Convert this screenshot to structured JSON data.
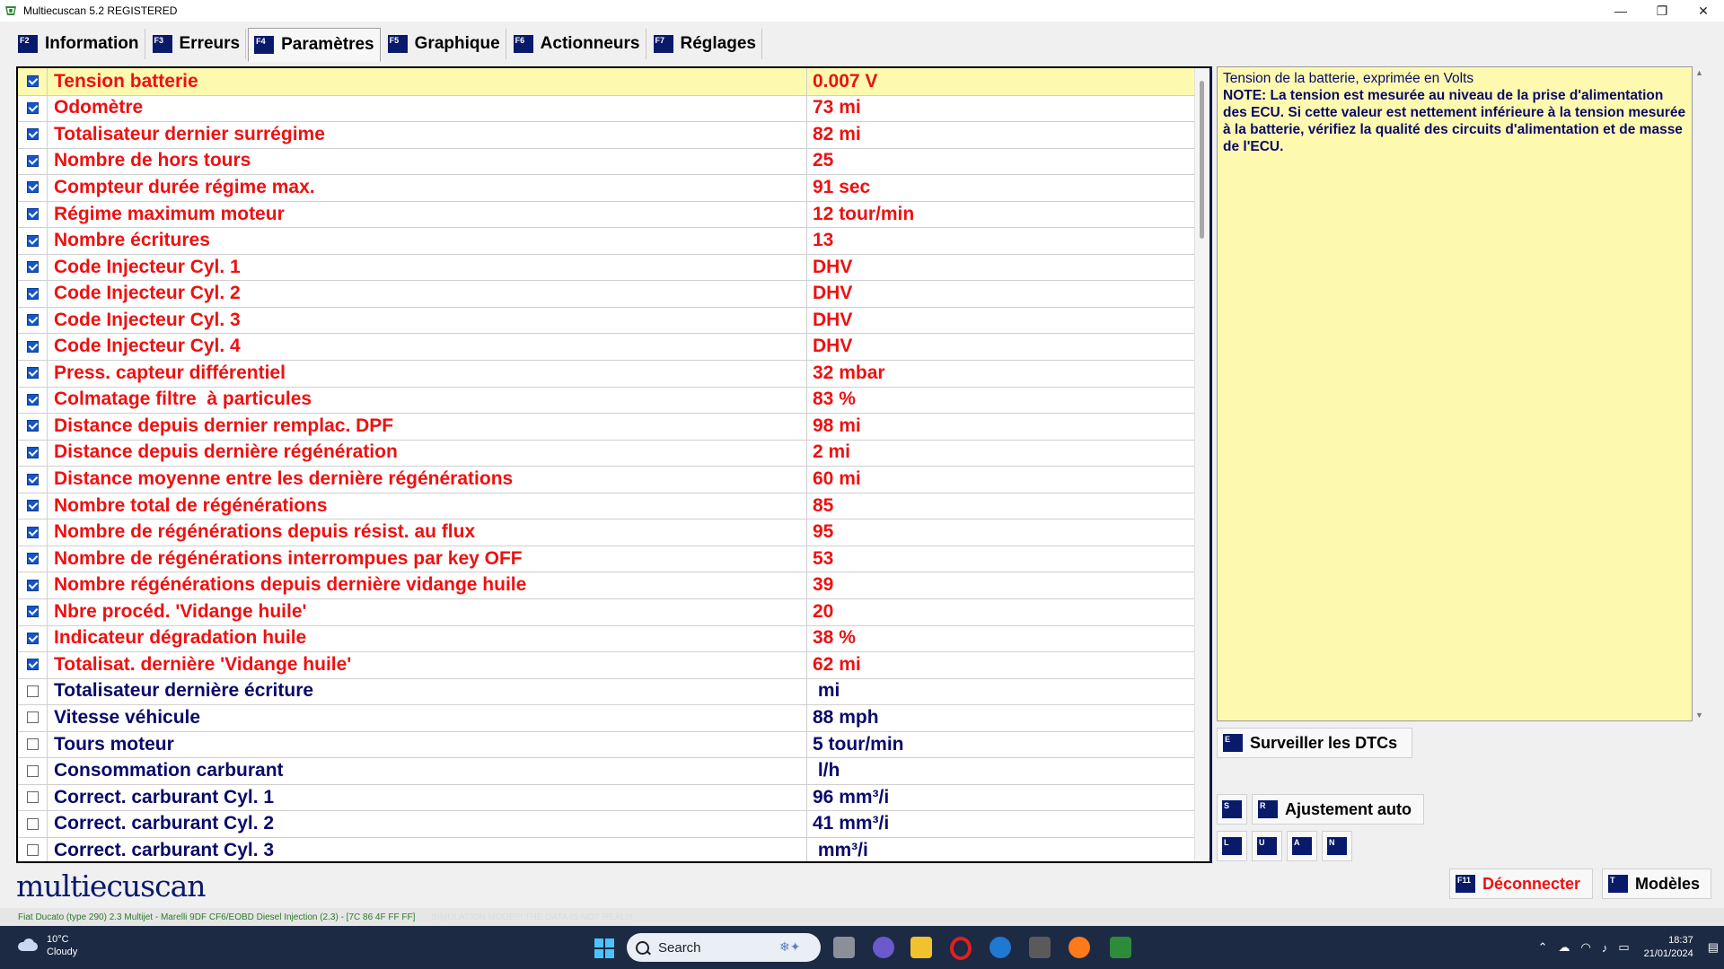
{
  "window": {
    "title": "Multiecuscan 5.2 REGISTERED",
    "controls": [
      "—",
      "❐",
      "✕"
    ]
  },
  "tabs": [
    {
      "key": "F2",
      "label": "Information"
    },
    {
      "key": "F3",
      "label": "Erreurs"
    },
    {
      "key": "F4",
      "label": "Paramètres"
    },
    {
      "key": "F5",
      "label": "Graphique"
    },
    {
      "key": "F6",
      "label": "Actionneurs"
    },
    {
      "key": "F7",
      "label": "Réglages"
    }
  ],
  "active_tab": "Paramètres",
  "parameters": [
    {
      "name": "Tension batterie",
      "value": "0.007 V",
      "checked": true
    },
    {
      "name": "Odomètre",
      "value": "73 mi",
      "checked": true
    },
    {
      "name": "Totalisateur dernier surrégime",
      "value": "82 mi",
      "checked": true
    },
    {
      "name": "Nombre de hors tours",
      "value": "25",
      "checked": true
    },
    {
      "name": "Compteur durée régime max.",
      "value": "91 sec",
      "checked": true
    },
    {
      "name": "Régime maximum moteur",
      "value": "12 tour/min",
      "checked": true
    },
    {
      "name": "Nombre écritures",
      "value": "13",
      "checked": true
    },
    {
      "name": "Code Injecteur Cyl. 1",
      "value": "DHV",
      "checked": true
    },
    {
      "name": "Code Injecteur Cyl. 2",
      "value": "DHV",
      "checked": true
    },
    {
      "name": "Code Injecteur Cyl. 3",
      "value": "DHV",
      "checked": true
    },
    {
      "name": "Code Injecteur Cyl. 4",
      "value": "DHV",
      "checked": true
    },
    {
      "name": "Press. capteur différentiel",
      "value": "32 mbar",
      "checked": true
    },
    {
      "name": "Colmatage filtre  à particules",
      "value": "83 %",
      "checked": true
    },
    {
      "name": "Distance depuis dernier remplac. DPF",
      "value": "98 mi",
      "checked": true
    },
    {
      "name": "Distance depuis dernière régénération",
      "value": "2 mi",
      "checked": true
    },
    {
      "name": "Distance moyenne entre les dernière régénérations",
      "value": "60 mi",
      "checked": true
    },
    {
      "name": "Nombre total de régénérations",
      "value": "85",
      "checked": true
    },
    {
      "name": "Nombre de régénérations depuis résist. au flux",
      "value": "95",
      "checked": true
    },
    {
      "name": "Nombre de régénérations interrompues par key OFF",
      "value": "53",
      "checked": true
    },
    {
      "name": "Nombre régénérations depuis dernière vidange huile",
      "value": "39",
      "checked": true
    },
    {
      "name": "Nbre procéd. 'Vidange huile'",
      "value": "20",
      "checked": true
    },
    {
      "name": "Indicateur dégradation huile",
      "value": "38 %",
      "checked": true
    },
    {
      "name": "Totalisat. dernière 'Vidange huile'",
      "value": "62 mi",
      "checked": true
    },
    {
      "name": "Totalisateur dernière écriture",
      "value": " mi",
      "checked": false
    },
    {
      "name": "Vitesse véhicule",
      "value": "88 mph",
      "checked": false
    },
    {
      "name": "Tours moteur",
      "value": "5 tour/min",
      "checked": false
    },
    {
      "name": "Consommation carburant",
      "value": " l/h",
      "checked": false
    },
    {
      "name": "Correct. carburant Cyl. 1",
      "value": "96 mm³/i",
      "checked": false
    },
    {
      "name": "Correct. carburant Cyl. 2",
      "value": "41 mm³/i",
      "checked": false
    },
    {
      "name": "Correct. carburant Cyl. 3",
      "value": " mm³/i",
      "checked": false
    }
  ],
  "description": {
    "line1": "Tension de la batterie, exprimée en Volts",
    "line2": "NOTE: La tension est mesurée au niveau de la prise d'alimentation des ECU. Si cette valeur est nettement inférieure à la tension mesurée à la batterie, vérifiez la qualité des circuits d'alimentation et de masse de l'ECU."
  },
  "buttons": {
    "monitor_dtc": {
      "key": "E",
      "label": "Surveiller les DTCs"
    },
    "s_key": "S",
    "auto_adjust": {
      "key": "R",
      "label": "Ajustement auto"
    },
    "small_keys": [
      "L",
      "U",
      "A",
      "N"
    ],
    "disconnect": {
      "key": "F11",
      "label": "Déconnecter"
    },
    "models": {
      "key": "T",
      "label": "Modèles"
    }
  },
  "logo": "multiecuscan",
  "status": {
    "vehicle": "Fiat Ducato (type 290) 2.3 Multijet - Marelli 9DF CF6/EOBD Diesel Injection (2.3) - [7C 86 4F FF FF]",
    "simulation": "SIMULATION MODE!!! THE DATA IS NOT REAL!!!"
  },
  "taskbar": {
    "weather_temp": "10°C",
    "weather_desc": "Cloudy",
    "search_placeholder": "Search",
    "time": "18:37",
    "date": "21/01/2024"
  },
  "colors": {
    "checked_text": "#ee1111",
    "unchecked_text": "#0a0a6a",
    "highlight": "#fdfab0",
    "key_badge": "#0a1a6b"
  }
}
